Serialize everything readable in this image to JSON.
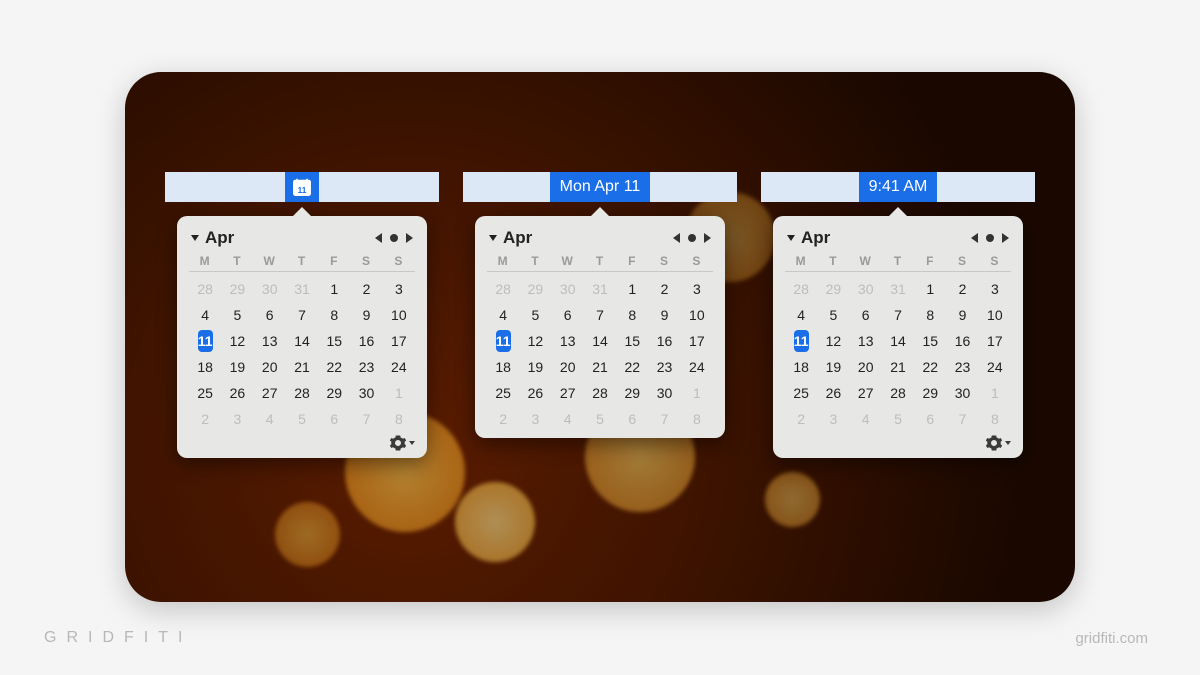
{
  "watermark": {
    "brand": "GRIDFITI",
    "site": "gridfiti.com"
  },
  "menubar_variants": {
    "icon": {
      "type": "icon",
      "glyph_day": "11"
    },
    "date": {
      "label": "Mon Apr 11"
    },
    "time": {
      "label": "9:41 AM"
    }
  },
  "calendar": {
    "month_label": "Apr",
    "dow": [
      "M",
      "T",
      "W",
      "T",
      "F",
      "S",
      "S"
    ],
    "today": 11,
    "weeks": [
      [
        {
          "n": 28,
          "o": true
        },
        {
          "n": 29,
          "o": true
        },
        {
          "n": 30,
          "o": true
        },
        {
          "n": 31,
          "o": true
        },
        {
          "n": 1
        },
        {
          "n": 2
        },
        {
          "n": 3
        }
      ],
      [
        {
          "n": 4
        },
        {
          "n": 5
        },
        {
          "n": 6
        },
        {
          "n": 7
        },
        {
          "n": 8
        },
        {
          "n": 9
        },
        {
          "n": 10
        }
      ],
      [
        {
          "n": 11
        },
        {
          "n": 12
        },
        {
          "n": 13
        },
        {
          "n": 14
        },
        {
          "n": 15
        },
        {
          "n": 16
        },
        {
          "n": 17
        }
      ],
      [
        {
          "n": 18
        },
        {
          "n": 19
        },
        {
          "n": 20
        },
        {
          "n": 21
        },
        {
          "n": 22
        },
        {
          "n": 23
        },
        {
          "n": 24
        }
      ],
      [
        {
          "n": 25
        },
        {
          "n": 26
        },
        {
          "n": 27
        },
        {
          "n": 28
        },
        {
          "n": 29
        },
        {
          "n": 30
        },
        {
          "n": 1,
          "o": true
        }
      ],
      [
        {
          "n": 2,
          "o": true
        },
        {
          "n": 3,
          "o": true
        },
        {
          "n": 4,
          "o": true
        },
        {
          "n": 5,
          "o": true
        },
        {
          "n": 6,
          "o": true
        },
        {
          "n": 7,
          "o": true
        },
        {
          "n": 8,
          "o": true
        }
      ]
    ]
  },
  "widgets": [
    {
      "id": "icon",
      "show_gear": true
    },
    {
      "id": "date",
      "show_gear": false
    },
    {
      "id": "time",
      "show_gear": true
    }
  ]
}
